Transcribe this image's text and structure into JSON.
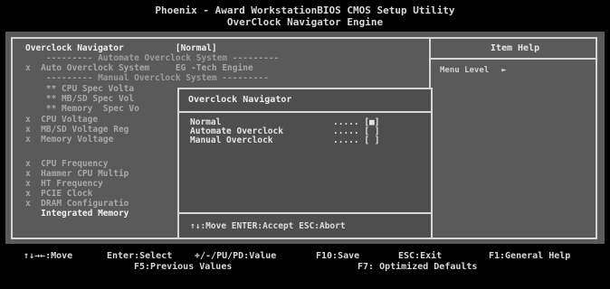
{
  "header": {
    "title_line1": "Phoenix - Award WorkstationBIOS CMOS Setup Utility",
    "title_line2": "OverClock Navigator Engine"
  },
  "left_menu": {
    "items": [
      {
        "label": "Overclock Navigator          [Normal]"
      },
      {
        "label": "    --------- Automate Overclock System ---------"
      },
      {
        "label": "x  Auto Overclock System     EG -Tech Engine"
      },
      {
        "label": "    --------- Manual Overclock System ---------"
      },
      {
        "label": "    ** CPU Spec Volta"
      },
      {
        "label": "    ** MB/SD Spec Vol"
      },
      {
        "label": "    ** Memory  Spec Vo"
      },
      {
        "label": "x  CPU Voltage"
      },
      {
        "label": "x  MB/SD Voltage Reg"
      },
      {
        "label": "x  Memory Voltage"
      },
      {
        "label": "x  CPU Frequency"
      },
      {
        "label": "x  Hammer CPU Multip"
      },
      {
        "label": "x  HT Frequency"
      },
      {
        "label": "x  PCIE Clock"
      },
      {
        "label": "x  DRAM Configuratio"
      },
      {
        "label": "   Integrated Memory"
      }
    ]
  },
  "help": {
    "title": "Item Help",
    "menu_level_label": "Menu Level",
    "menu_level_arrow": "►"
  },
  "popup": {
    "title": "Overclock Navigator",
    "options": [
      {
        "label": "Normal",
        "dots": "..... [■]"
      },
      {
        "label": "Automate Overclock",
        "dots": "..... [ ]"
      },
      {
        "label": "Manual Overclock",
        "dots": "..... [ ]"
      }
    ],
    "footer": "↑↓:Move ENTER:Accept ESC:Abort"
  },
  "footer": {
    "move": "↑↓→←:Move",
    "enter": "Enter:Select",
    "value": "+/-/PU/PD:Value",
    "f10": "F10:Save",
    "esc": "ESC:Exit",
    "f1": "F1:General Help",
    "f5": "F5:Previous Values",
    "f7": "F7: Optimized Defaults"
  }
}
